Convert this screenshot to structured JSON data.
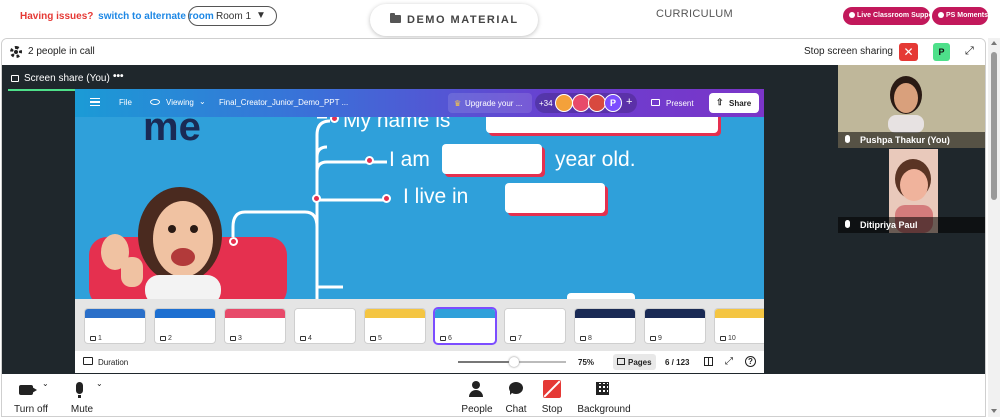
{
  "topbar": {
    "issues_text": "Having issues?",
    "switch_link": "switch to alternate room",
    "room_select": "Room 1",
    "demo_material": "DEMO MATERIAL",
    "curriculum": "CURRICULUM",
    "live_support": "Live Classroom Support",
    "ps_moments": "PS Moments"
  },
  "call": {
    "people_count": "2 people in call",
    "stop_sharing": "Stop screen sharing",
    "avatar_initial": "P",
    "screen_share_tab": "Screen share (You)",
    "more_glyph": "•••"
  },
  "editor": {
    "file": "File",
    "viewing": "Viewing",
    "file_name": "Final_Creator_Junior_Demo_PPT ...",
    "upgrade": "Upgrade your ...",
    "collaborators_more": "+34",
    "collaborator_initial": "P",
    "present": "Present",
    "share": "Share",
    "duration": "Duration",
    "zoom": "75%",
    "zoom_fraction": 0.52,
    "pages": "Pages",
    "page_count": "6 / 123",
    "help": "?"
  },
  "slide": {
    "heading_fragment": "me",
    "line1": "My name is",
    "line2a": "I am",
    "line2b": "year old.",
    "line3": "I live in"
  },
  "thumbnails": [
    {
      "num": "1",
      "band": "#2a6fc9"
    },
    {
      "num": "2",
      "band": "#1d6fd1"
    },
    {
      "num": "3",
      "band": "#e84a6a"
    },
    {
      "num": "4",
      "band": "#ffffff"
    },
    {
      "num": "5",
      "band": "#f4c542"
    },
    {
      "num": "6",
      "band": "#2fa0da"
    },
    {
      "num": "7",
      "band": "#ffffff"
    },
    {
      "num": "8",
      "band": "#1a2a55"
    },
    {
      "num": "9",
      "band": "#1a2a55"
    },
    {
      "num": "10",
      "band": "#f4c542"
    }
  ],
  "participants": [
    {
      "name": "Pushpa Thakur (You)"
    },
    {
      "name": "Ditipriya Paul"
    }
  ],
  "controls": {
    "turn_off": "Turn off",
    "mute": "Mute",
    "people": "People",
    "chat": "Chat",
    "stop": "Stop",
    "background": "Background"
  },
  "colors": {
    "accent_green": "#4ee08a",
    "alert_red": "#e53935",
    "brand_pink": "#c2185b",
    "slide_blue": "#2fa0da"
  }
}
